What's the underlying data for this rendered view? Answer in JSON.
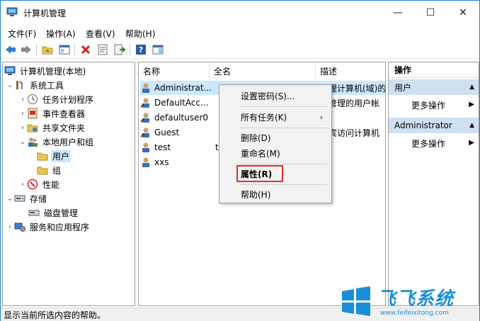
{
  "window": {
    "title": "计算机管理",
    "controls": {
      "minimize": "—",
      "maximize": "☐",
      "close": "✕"
    }
  },
  "menu": [
    "文件(F)",
    "操作(A)",
    "查看(V)",
    "帮助(H)"
  ],
  "tree": {
    "root": "计算机管理(本地)",
    "system_tools": "系统工具",
    "task_scheduler": "任务计划程序",
    "event_viewer": "事件查看器",
    "shared_folders": "共享文件夹",
    "local_users_groups": "本地用户和组",
    "users": "用户",
    "groups": "组",
    "performance": "性能",
    "storage": "存储",
    "disk_management": "磁盘管理",
    "services_apps": "服务和应用程序"
  },
  "list": {
    "columns": {
      "name": "名称",
      "fullname": "全名",
      "description": "描述"
    },
    "rows": [
      {
        "name": "Administrat...",
        "fullname": "",
        "description": "管理计算机(域)的"
      },
      {
        "name": "DefaultAcc...",
        "fullname": "",
        "description": "统管理的用户帐"
      },
      {
        "name": "defaultuser0",
        "fullname": "",
        "description": ""
      },
      {
        "name": "Guest",
        "fullname": "",
        "description": "来宾访问计算机"
      },
      {
        "name": "test",
        "fullname": "t",
        "description": ""
      },
      {
        "name": "xxs",
        "fullname": "",
        "description": ""
      }
    ]
  },
  "context_menu": {
    "set_password": "设置密码(S)...",
    "all_tasks": "所有任务(K)",
    "submenu_arrow": "›",
    "delete": "删除(D)",
    "rename": "重命名(M)",
    "properties": "属性(R)",
    "help": "帮助(H)"
  },
  "actions": {
    "title": "操作",
    "section1": "用户",
    "more1": "更多操作",
    "section2": "Administrator",
    "more2": "更多操作"
  },
  "status": "显示当前所选内容的帮助。",
  "watermark": {
    "brand": "飞飞系统",
    "url": "www.feifeixitong.com"
  },
  "colors": {
    "accent": "#1883d7",
    "selection": "#cce8ff",
    "section": "#cfe0f1",
    "highlight_box": "#e03030"
  }
}
